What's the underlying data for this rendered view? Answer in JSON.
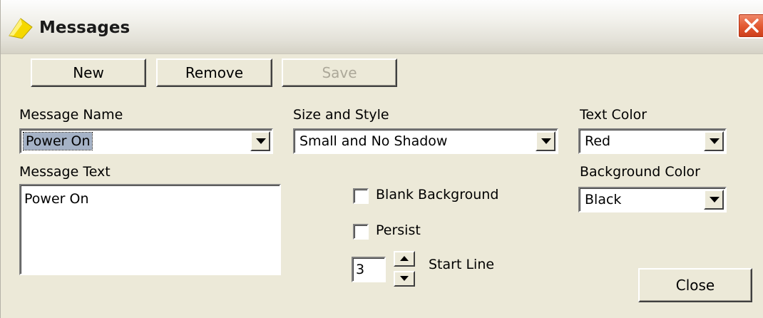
{
  "window": {
    "title": "Messages"
  },
  "toolbar": {
    "new_label": "New",
    "remove_label": "Remove",
    "save_label": "Save"
  },
  "message_name": {
    "label": "Message Name",
    "value": "Power On"
  },
  "size_style": {
    "label": "Size and Style",
    "value": "Small and No Shadow"
  },
  "text_color": {
    "label": "Text Color",
    "value": "Red"
  },
  "background_color": {
    "label": "Background Color",
    "value": "Black"
  },
  "message_text": {
    "label": "Message Text",
    "value": "Power On"
  },
  "options": {
    "blank_background_label": "Blank Background",
    "persist_label": "Persist"
  },
  "start_line": {
    "value": "3",
    "label": "Start Line"
  },
  "footer": {
    "close_label": "Close"
  },
  "icons": {
    "app": "yellow-arrow-icon",
    "close": "close-icon",
    "dropdown": "chevron-down-icon",
    "spin_up": "spin-up-icon",
    "spin_down": "spin-down-icon"
  }
}
